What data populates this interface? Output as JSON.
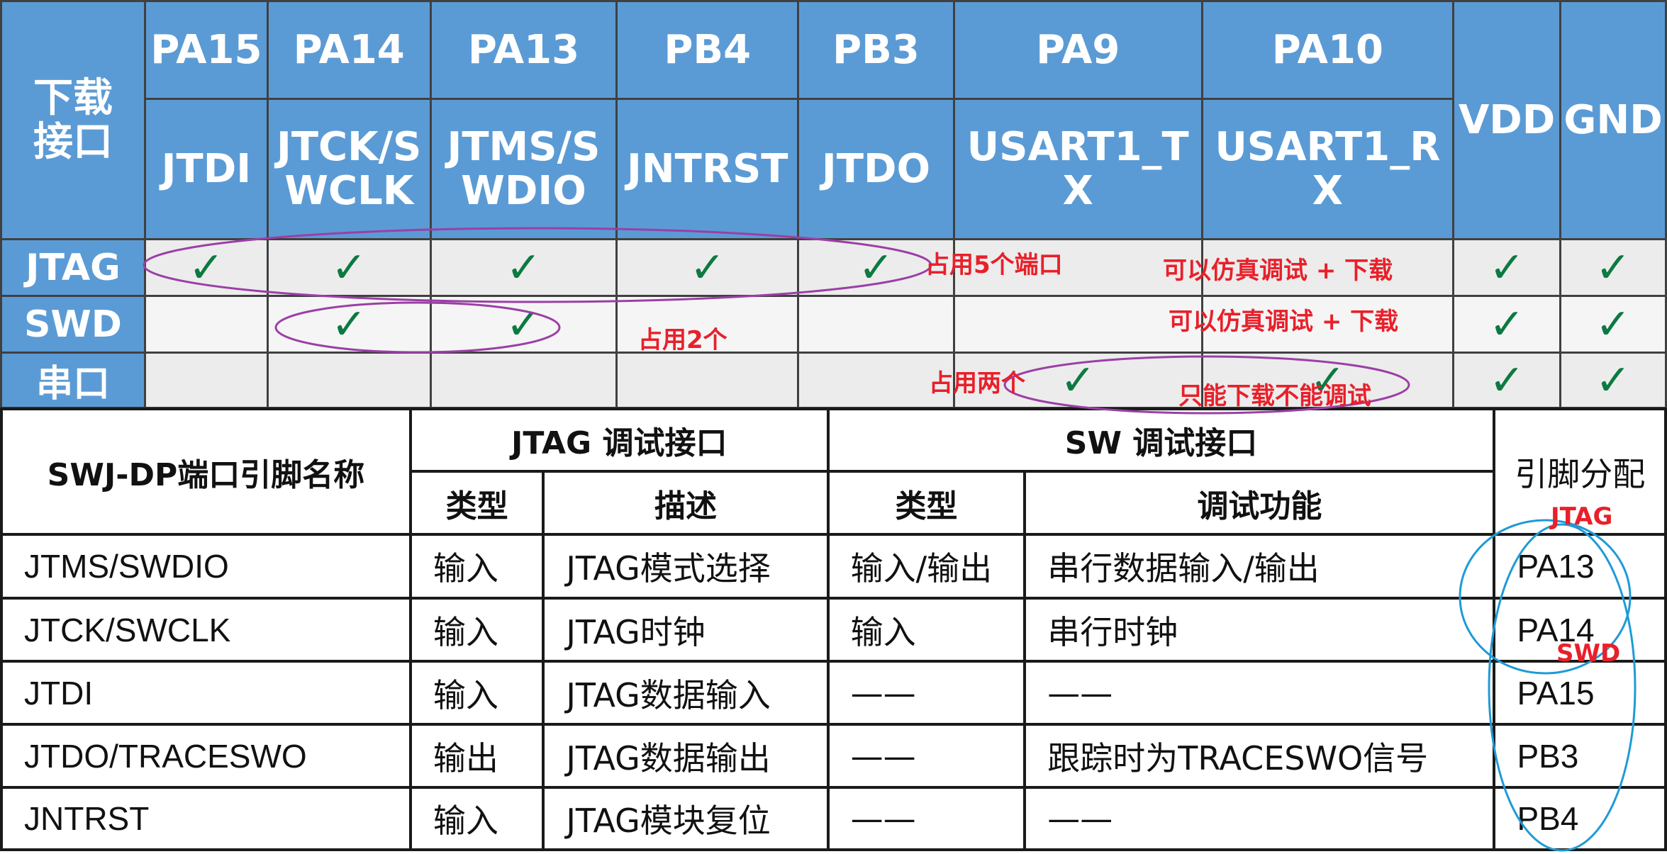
{
  "top_table": {
    "corner_label": "下载\n接口",
    "pins": [
      "PA15",
      "PA14",
      "PA13",
      "PB4",
      "PB3",
      "PA9",
      "PA10"
    ],
    "pin_functions": [
      "JTDI",
      "JTCK/SWCLK",
      "JTMS/SWDIO",
      "JNTRST",
      "JTDO",
      "USART1_TX",
      "USART1_RX"
    ],
    "power": [
      "VDD",
      "GND"
    ],
    "rows": [
      {
        "name": "JTAG",
        "checks": [
          true,
          true,
          true,
          true,
          true,
          false,
          false,
          true,
          true
        ]
      },
      {
        "name": "SWD",
        "checks": [
          false,
          true,
          true,
          false,
          false,
          false,
          false,
          true,
          true
        ]
      },
      {
        "name": "串口",
        "checks": [
          false,
          false,
          false,
          false,
          false,
          true,
          true,
          true,
          true
        ]
      }
    ],
    "check_symbol": "✓"
  },
  "bottom_table": {
    "header_name": "SWJ-DP端口引脚名称",
    "jtag_group": "JTAG 调试接口",
    "sw_group": "SW 调试接口",
    "pin_assign": "引脚分配",
    "type_label": "类型",
    "desc_label": "描述",
    "func_label": "调试功能",
    "rows": [
      {
        "name": "JTMS/SWDIO",
        "jtag_type": "输入",
        "jtag_desc": "JTAG模式选择",
        "sw_type": "输入/输出",
        "sw_func": "串行数据输入/输出",
        "pin": "PA13"
      },
      {
        "name": "JTCK/SWCLK",
        "jtag_type": "输入",
        "jtag_desc": "JTAG时钟",
        "sw_type": "输入",
        "sw_func": "串行时钟",
        "pin": "PA14"
      },
      {
        "name": "JTDI",
        "jtag_type": "输入",
        "jtag_desc": "JTAG数据输入",
        "sw_type": "——",
        "sw_func": "——",
        "pin": "PA15"
      },
      {
        "name": "JTDO/TRACESWO",
        "jtag_type": "输出",
        "jtag_desc": "JTAG数据输出",
        "sw_type": "——",
        "sw_func": "跟踪时为TRACESWO信号",
        "pin": "PB3"
      },
      {
        "name": "JNTRST",
        "jtag_type": "输入",
        "jtag_desc": "JTAG模块复位",
        "sw_type": "——",
        "sw_func": "——",
        "pin": "PB4"
      }
    ]
  },
  "annotations": {
    "jtag_ports": "占用5个端口",
    "jtag_note": "可以仿真调试 + 下载",
    "swd_ports": "占用2个",
    "swd_note": "可以仿真调试 + 下载",
    "serial_ports": "占用两个",
    "serial_note": "只能下载不能调试",
    "jtag_tag": "JTAG",
    "swd_tag": "SWD"
  },
  "colors": {
    "header_blue": "#5B9BD5",
    "check_green": "#0c7a41",
    "annotation_red": "#e8202a",
    "ellipse_purple": "#9b3fa6",
    "ellipse_blue": "#1f9ad6"
  }
}
